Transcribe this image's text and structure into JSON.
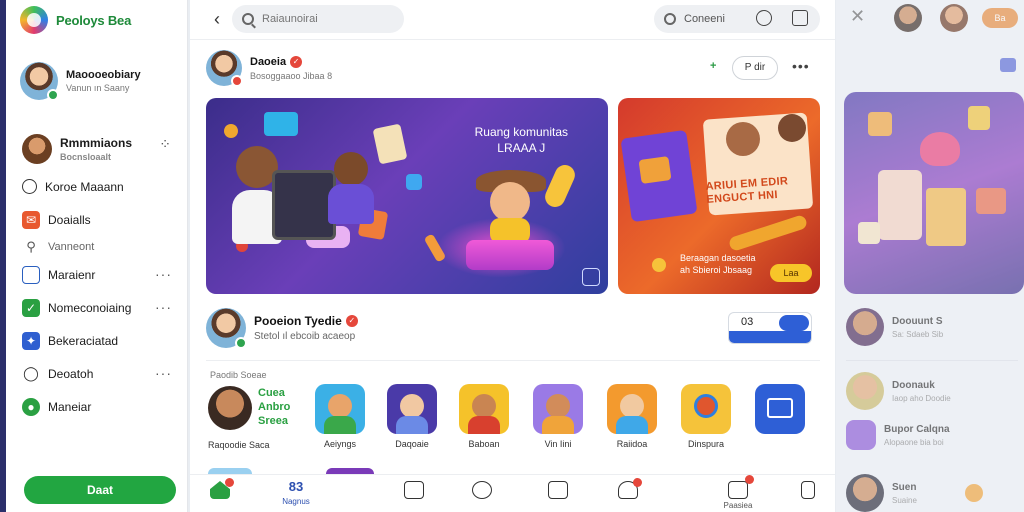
{
  "app": {
    "name": "Peoloys Bea"
  },
  "profile": {
    "name": "Maoooeobiary",
    "sub": "Vanun ın Saany"
  },
  "nav": [
    {
      "label": "Rmmmiaons",
      "sub": "Bocnsloaalt",
      "icon": "avatar-icon"
    },
    {
      "label": "Koroe Maaann",
      "icon": "clock-icon"
    },
    {
      "label": "Doaialls",
      "icon": "mail-icon"
    },
    {
      "label": "Vanneont",
      "icon": "pin-icon"
    },
    {
      "label": "Maraienr",
      "icon": "calendar-icon"
    },
    {
      "label": "Nomeconoiaing",
      "icon": "check-icon"
    },
    {
      "label": "Bekeraciatad",
      "icon": "star-icon"
    },
    {
      "label": "Deoatoh",
      "icon": "chat-icon"
    },
    {
      "label": "Maneiar",
      "icon": "shield-icon"
    }
  ],
  "sidebar_button": "Daat",
  "topbar": {
    "search_placeholder": "Raiaunoirai",
    "search2_label": "Coneeni"
  },
  "post": {
    "author": "Daoeia",
    "meta": "Bosoggaaoo Jibaa 8",
    "follow_label": "P dir",
    "plus_label": "+"
  },
  "banner1": {
    "title_line1": "Ruang komunitas",
    "title_line2": "LRAAA J"
  },
  "banner2": {
    "headline_line1": "ARIUI EM EDIR",
    "headline_line2": "ENGUCT HNI",
    "caption_line1": "Beraagan dasoetia",
    "caption_line2": "ah Sbieroi Jbsaag",
    "chip": "Laa"
  },
  "post2": {
    "author": "Pooeion Tyedie",
    "meta": "Stetol ıl ebcoib acaeop"
  },
  "counter": {
    "value": "03"
  },
  "section_label": "Paodib Soeae",
  "featured": {
    "line1": "Cuea",
    "line2": "Anbro",
    "line3": "Sreea",
    "label": "Raqoodie Saca"
  },
  "tiles": [
    {
      "label": "Aeiyngs"
    },
    {
      "label": "Daqoaie"
    },
    {
      "label": "Baboan"
    },
    {
      "label": "Vin Iini"
    },
    {
      "label": "Raiidoa"
    },
    {
      "label": "Dinspura"
    }
  ],
  "bottom_nav": {
    "active_label": "Nagnus",
    "active_num": "83",
    "last_label": "Paasiea"
  },
  "right": {
    "badge": "Ba",
    "rows": [
      {
        "name": "Doouunt S",
        "sub": "Sa: Sdaeb Sib"
      },
      {
        "name": "Doonauk",
        "sub": "Iaop aho Doodie"
      },
      {
        "name": "Bupor Calqna",
        "sub": "Alopaone bia boi"
      },
      {
        "name": "Suen",
        "sub": "Suaine"
      }
    ]
  },
  "colors": {
    "brand_green": "#22a641",
    "accent_blue": "#2c4fb0",
    "alert_red": "#e5473b"
  }
}
